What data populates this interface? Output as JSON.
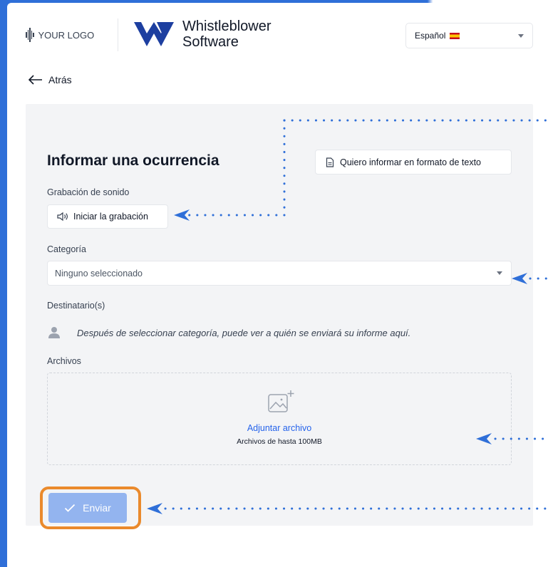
{
  "header": {
    "your_logo": "YOUR LOGO",
    "brand_line1": "Whistleblower",
    "brand_line2": "Software",
    "language": "Español",
    "brand_color": "#1d3fa0"
  },
  "nav": {
    "back_label": "Atrás"
  },
  "form": {
    "title": "Informar una ocurrencia",
    "text_format_button": "Quiero informar en formato de texto",
    "sound_label": "Grabación de sonido",
    "record_button": "Iniciar la grabación",
    "category_label": "Categoría",
    "category_value": "Ninguno seleccionado",
    "recipients_label": "Destinatario(s)",
    "recipients_hint": "Después de seleccionar categoría, puede ver a quién se enviará su informe aquí.",
    "files_label": "Archivos",
    "attach_link": "Adjuntar archivo",
    "attach_limit": "Archivos de hasta 100MB",
    "submit_button": "Enviar"
  },
  "colors": {
    "accent": "#2f6fd8",
    "link": "#2563eb",
    "submit_bg": "#93b4ef",
    "highlight": "#ea8a2c",
    "panel_bg": "#f3f4f6"
  },
  "icons": [
    "logo-bars-icon",
    "brand-logo-icon",
    "chevron-down-icon",
    "arrow-left-icon",
    "document-icon",
    "speaker-icon",
    "user-icon",
    "image-plus-icon",
    "check-icon"
  ]
}
